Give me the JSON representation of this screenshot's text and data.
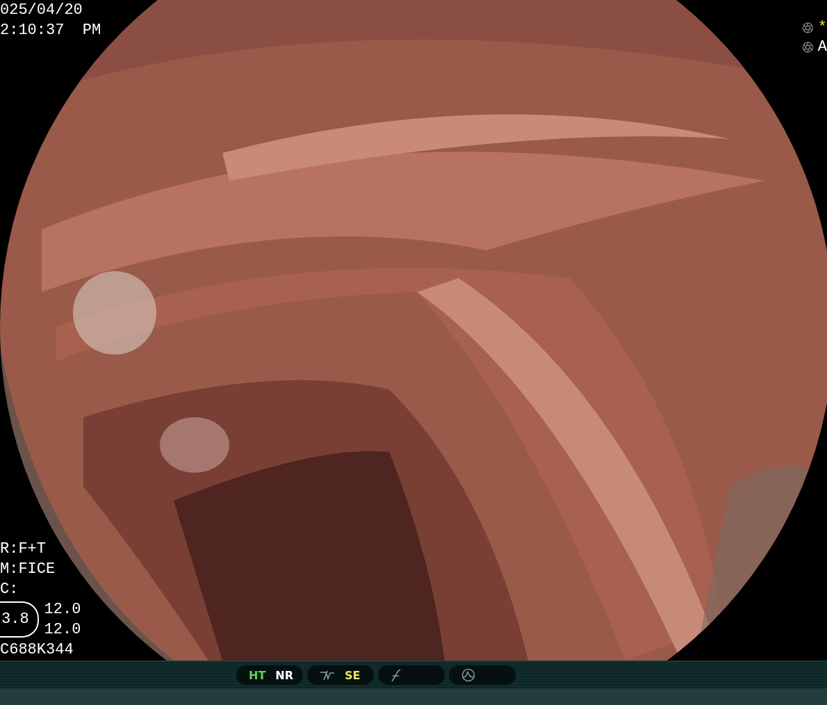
{
  "timestamp": {
    "date": "025/04/20",
    "time": "2:10:37  PM"
  },
  "settings": {
    "lines": [
      "R:F+T",
      "M:FICE",
      "C:"
    ],
    "circled_value": "3.8",
    "values": [
      "12.0",
      "12.0"
    ],
    "code": "C688K344"
  },
  "indicators": [
    {
      "symbol": "*",
      "color": "#f0e040"
    },
    {
      "symbol": "A",
      "color": "#ffffff"
    }
  ],
  "status_bar": {
    "pills": [
      {
        "labels": [
          {
            "text": "HT",
            "color": "#5cd65c"
          },
          {
            "text": "NR",
            "color": "#ffffff"
          }
        ]
      },
      {
        "labels": [
          {
            "text": "SE",
            "color": "#e6e65a"
          }
        ]
      }
    ]
  }
}
